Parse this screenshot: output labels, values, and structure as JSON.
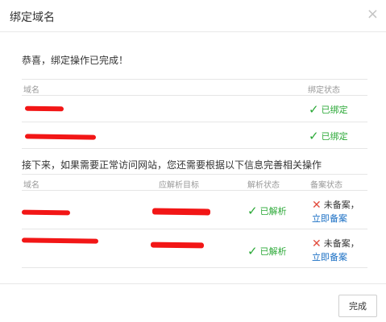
{
  "dialog": {
    "title": "绑定域名",
    "close_symbol": "×",
    "success_message": "恭喜，绑定操作已完成！",
    "next_message": "接下来，如果需要正常访问网站，您还需要根据以下信息完善相关操作",
    "done_button": "完成"
  },
  "bind_table": {
    "headers": [
      "域名",
      "绑定状态"
    ],
    "rows": [
      {
        "status": "已绑定"
      },
      {
        "status": "已绑定"
      }
    ]
  },
  "dns_table": {
    "headers": [
      "域名",
      "应解析目标",
      "解析状态",
      "备案状态"
    ],
    "rows": [
      {
        "resolve_status": "已解析",
        "record_status": "未备案，",
        "record_link": "立即备案"
      },
      {
        "resolve_status": "已解析",
        "record_status": "未备案，",
        "record_link": "立即备案"
      }
    ]
  },
  "icons": {
    "check": "check-icon",
    "cross": "cross-icon",
    "close": "close-icon"
  },
  "colors": {
    "success": "#2aa836",
    "error": "#e24b3c",
    "link": "#1a6fc4",
    "redaction": "#f21616"
  }
}
